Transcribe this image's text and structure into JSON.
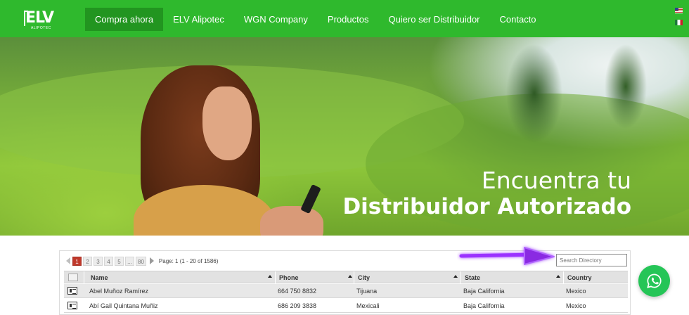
{
  "header": {
    "logo_text": "ELV",
    "logo_subtext": "ALIPOTEC",
    "nav": [
      {
        "label": "Compra ahora",
        "active": true
      },
      {
        "label": "ELV Alipotec",
        "active": false
      },
      {
        "label": "WGN Company",
        "active": false
      },
      {
        "label": "Productos",
        "active": false
      },
      {
        "label": "Quiero ser Distribuidor",
        "active": false
      },
      {
        "label": "Contacto",
        "active": false
      }
    ],
    "languages": [
      "us-flag-icon",
      "mexico-flag-icon"
    ],
    "colors": {
      "nav_bg": "#2fb92d",
      "nav_active": "#229520"
    }
  },
  "hero": {
    "line1": "Encuentra tu",
    "line2": "Distribuidor Autorizado"
  },
  "directory": {
    "pagination": {
      "pages": [
        "1",
        "2",
        "3",
        "4",
        "5",
        "...",
        "80"
      ],
      "current": "1",
      "info": "Page: 1 (1 - 20 of 1586)"
    },
    "search_placeholder": "Search Directory",
    "columns": [
      "Name",
      "Phone",
      "City",
      "State",
      "Country"
    ],
    "rows": [
      {
        "name": "Abel Muñoz Ramírez",
        "phone": "664 750 8832",
        "city": "Tijuana",
        "state": "Baja California",
        "country": "Mexico"
      },
      {
        "name": "Abí Gail Quintana Muñiz",
        "phone": "686 209 3838",
        "city": "Mexicali",
        "state": "Baja California",
        "country": "Mexico"
      }
    ],
    "accent_color": "#c0392b"
  },
  "annotation": {
    "color": "#8a2be2",
    "icon": "arrow-right-icon"
  },
  "whatsapp": {
    "icon": "whatsapp-icon",
    "color": "#25c557"
  }
}
